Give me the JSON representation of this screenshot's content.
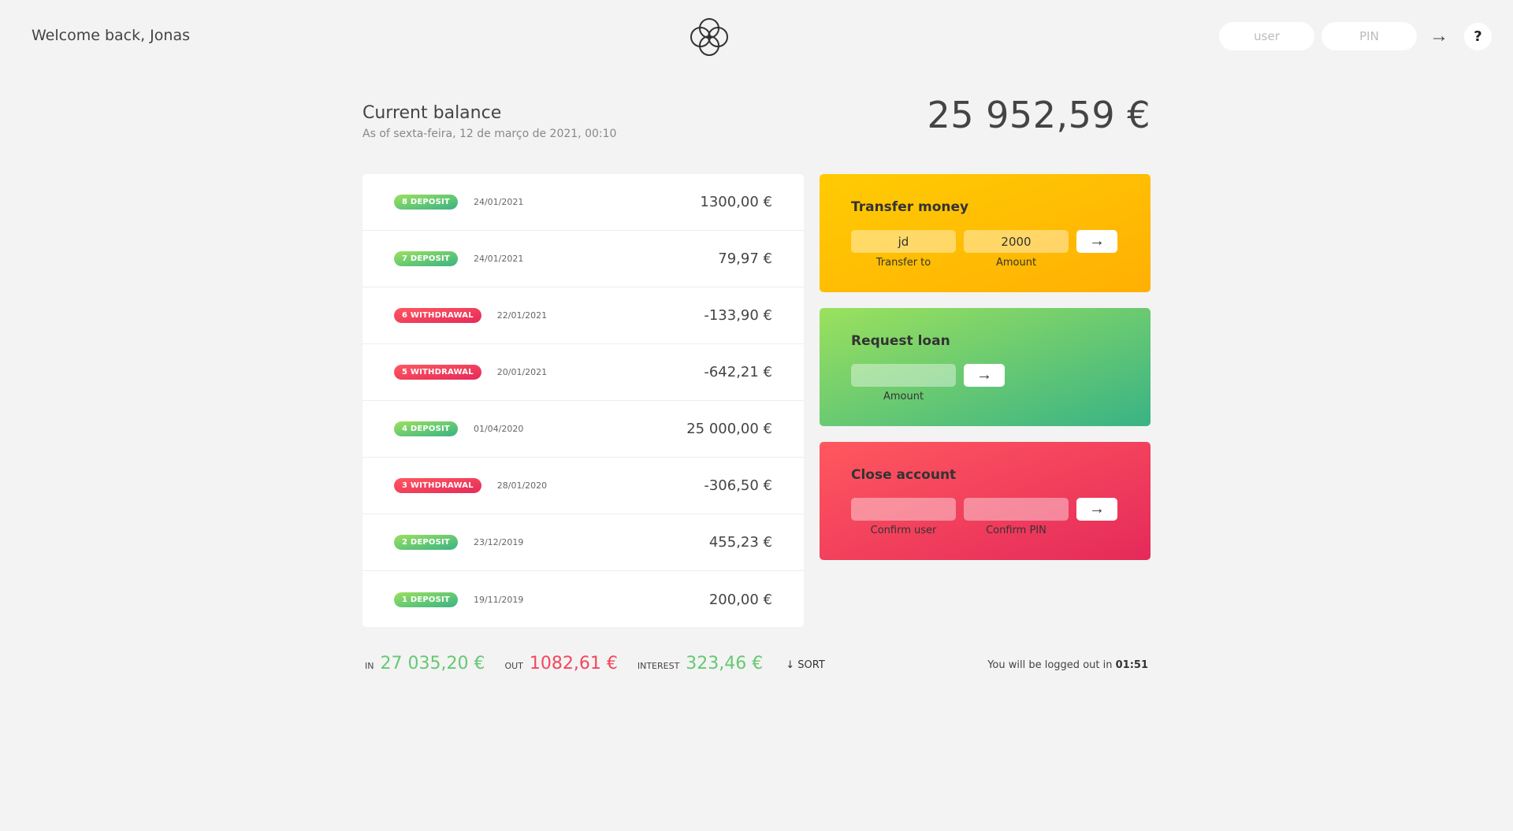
{
  "nav": {
    "welcome": "Welcome back, Jonas",
    "user_placeholder": "user",
    "pin_placeholder": "PIN",
    "login_icon": "arrow-right-icon",
    "login_label": "→",
    "help_label": "?"
  },
  "balance": {
    "label": "Current balance",
    "date": "As of sexta-feira, 12 de março de 2021, 00:10",
    "value": "25 952,59 €"
  },
  "movements": [
    {
      "type_label": "8 deposit",
      "type": "deposit",
      "date": "24/01/2021",
      "value": "1300,00 €"
    },
    {
      "type_label": "7 deposit",
      "type": "deposit",
      "date": "24/01/2021",
      "value": "79,97 €"
    },
    {
      "type_label": "6 withdrawal",
      "type": "withdrawal",
      "date": "22/01/2021",
      "value": "-133,90 €"
    },
    {
      "type_label": "5 withdrawal",
      "type": "withdrawal",
      "date": "20/01/2021",
      "value": "-642,21 €"
    },
    {
      "type_label": "4 deposit",
      "type": "deposit",
      "date": "01/04/2020",
      "value": "25 000,00 €"
    },
    {
      "type_label": "3 withdrawal",
      "type": "withdrawal",
      "date": "28/01/2020",
      "value": "-306,50 €"
    },
    {
      "type_label": "2 deposit",
      "type": "deposit",
      "date": "23/12/2019",
      "value": "455,23 €"
    },
    {
      "type_label": "1 deposit",
      "type": "deposit",
      "date": "19/11/2019",
      "value": "200,00 €"
    }
  ],
  "operations": {
    "transfer": {
      "title": "Transfer money",
      "to_value": "jd",
      "to_label": "Transfer to",
      "amount_value": "2000",
      "amount_label": "Amount",
      "btn_label": "→"
    },
    "loan": {
      "title": "Request loan",
      "amount_value": "",
      "amount_label": "Amount",
      "btn_label": "→"
    },
    "close": {
      "title": "Close account",
      "user_value": "",
      "user_label": "Confirm user",
      "pin_value": "",
      "pin_label": "Confirm PIN",
      "btn_label": "→"
    }
  },
  "summary": {
    "in_label": "In",
    "in_value": "27 035,20 €",
    "out_label": "Out",
    "out_value": "1082,61 €",
    "interest_label": "Interest",
    "interest_value": "323,46 €",
    "sort_label": "↓ SORT"
  },
  "logout": {
    "text": "You will be logged out in ",
    "timer": "01:51"
  },
  "colors": {
    "background": "#f3f3f3",
    "deposit": "#66c873",
    "withdrawal": "#f5465d",
    "transfer_card": "#ffb003",
    "loan_card": "#39b385",
    "close_card": "#e52a5a"
  }
}
